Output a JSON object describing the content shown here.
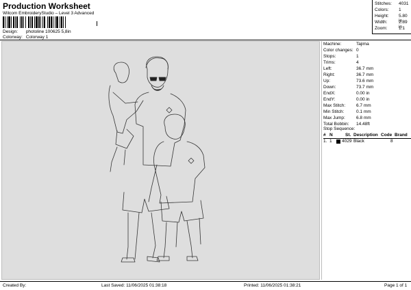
{
  "header": {
    "title": "Production Worksheet",
    "subtitle": "Wilcom EmbroideryStudio – Level 3 Advanced",
    "design_label": "Design:",
    "design_value": "photoline 100625 5,8in",
    "colorway_label": "Colorway:",
    "colorway_value": "Colorway 1"
  },
  "stats": [
    {
      "label": "Stitches:",
      "value": "4031"
    },
    {
      "label": "Colors:",
      "value": "1"
    },
    {
      "label": "Height:",
      "value": "5.80 in"
    },
    {
      "label": "Width:",
      "value": "2.89 in"
    },
    {
      "label": "Zoom:",
      "value": "1:1"
    }
  ],
  "properties": [
    {
      "label": "Machine:",
      "value": "Tajima"
    },
    {
      "label": "Color changes:",
      "value": "0"
    },
    {
      "label": "Stops:",
      "value": "1"
    },
    {
      "label": "Trims:",
      "value": "4"
    },
    {
      "label": "Left:",
      "value": "36.7 mm"
    },
    {
      "label": "Right:",
      "value": "36.7 mm"
    },
    {
      "label": "Up:",
      "value": "73.6 mm"
    },
    {
      "label": "Down:",
      "value": "73.7 mm"
    },
    {
      "label": "EndX:",
      "value": "0.00 in"
    },
    {
      "label": "EndY:",
      "value": "0.00 in"
    },
    {
      "label": "Max Stitch:",
      "value": "6.7 mm"
    },
    {
      "label": "Min Stitch:",
      "value": "0.1 mm"
    },
    {
      "label": "Max Jump:",
      "value": "6.8 mm"
    },
    {
      "label": "Total Bobbin:",
      "value": "14.48ft"
    }
  ],
  "stop_sequence": {
    "title": "Stop Sequence:",
    "columns": [
      "#",
      "N",
      "St.",
      "Description",
      "Code",
      "Brand"
    ],
    "rows": [
      {
        "num": "1.",
        "n": "1",
        "st": "4029",
        "description": "Black",
        "code": "",
        "brand": "8",
        "swatch_color": "#000000"
      }
    ]
  },
  "footer": {
    "created_by": "Created By:",
    "last_saved": "Last Saved: 11/06/2025 01:38:18",
    "printed": "Printed: 11/06/2025 01:38:21",
    "page": "Page 1 of 1"
  },
  "colors": {
    "canvas_bg": "#dedede",
    "line_color": "#333333"
  }
}
